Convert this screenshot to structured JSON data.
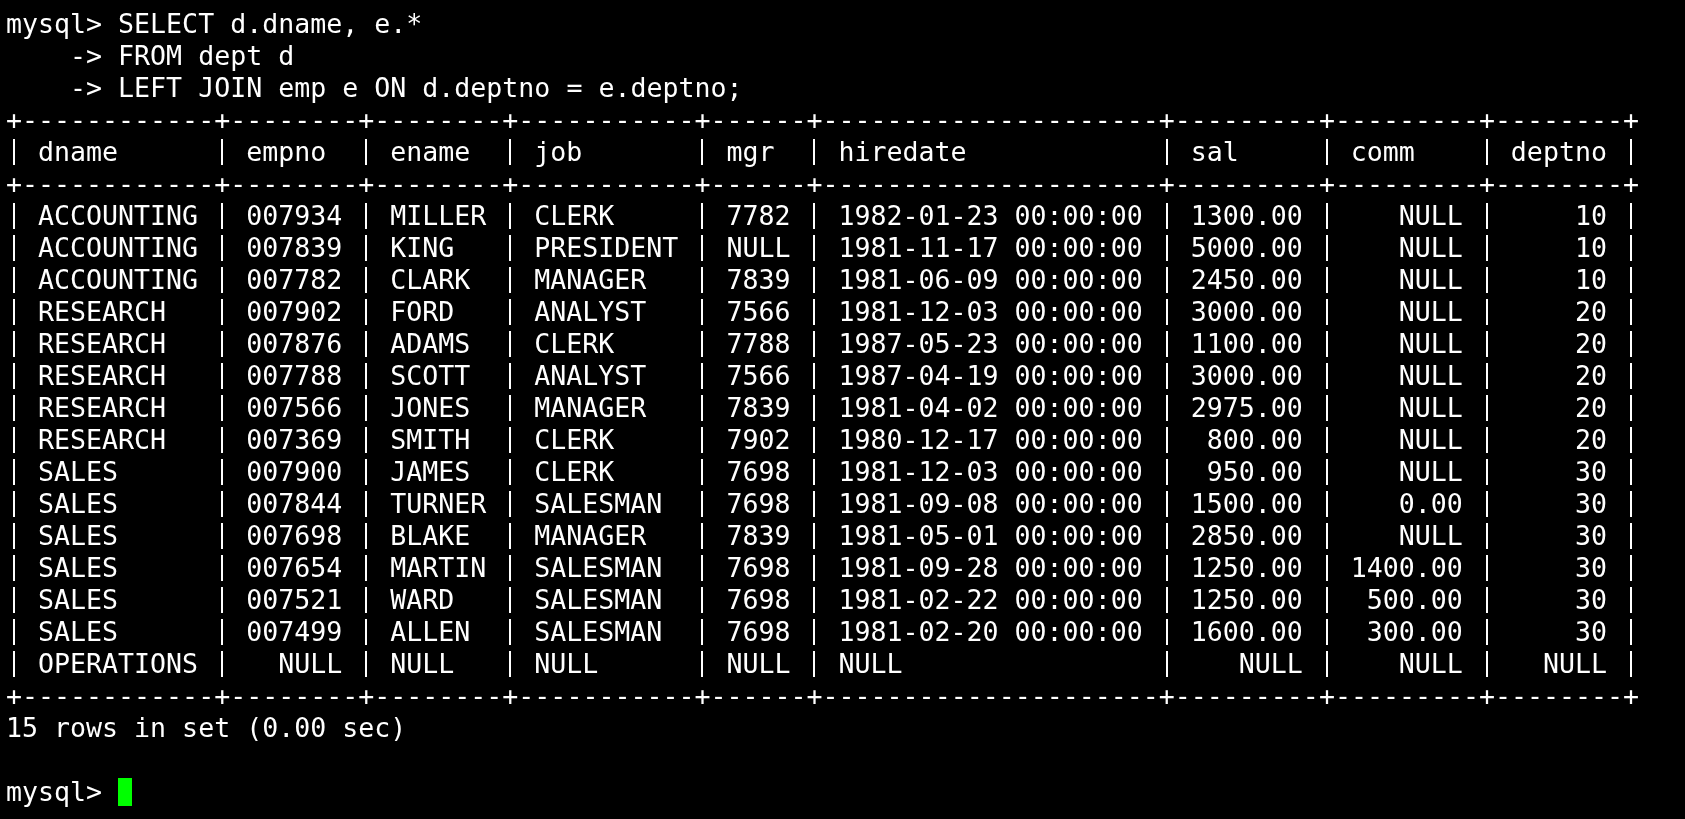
{
  "terminal": {
    "query_lines": [
      "mysql> SELECT d.dname, e.*",
      "    -> FROM dept d",
      "    -> LEFT JOIN emp e ON d.deptno = e.deptno;"
    ],
    "result_table": {
      "border_top": "+------------+--------+--------+-----------+------+---------------------+---------+---------+--------+",
      "columns": [
        {
          "name": "dname",
          "kind": "text"
        },
        {
          "name": "empno",
          "kind": "numeric"
        },
        {
          "name": "ename",
          "kind": "text"
        },
        {
          "name": "job",
          "kind": "text"
        },
        {
          "name": "mgr",
          "kind": "numeric"
        },
        {
          "name": "hiredate",
          "kind": "text"
        },
        {
          "name": "sal",
          "kind": "numeric"
        },
        {
          "name": "comm",
          "kind": "numeric"
        },
        {
          "name": "deptno",
          "kind": "numeric"
        }
      ],
      "border_header": "+------------+--------+--------+-----------+------+---------------------+---------+---------+--------+",
      "rows": [
        [
          "ACCOUNTING",
          "007934",
          "MILLER",
          "CLERK",
          "7782",
          "1982-01-23 00:00:00",
          "1300.00",
          "NULL",
          "10"
        ],
        [
          "ACCOUNTING",
          "007839",
          "KING",
          "PRESIDENT",
          "NULL",
          "1981-11-17 00:00:00",
          "5000.00",
          "NULL",
          "10"
        ],
        [
          "ACCOUNTING",
          "007782",
          "CLARK",
          "MANAGER",
          "7839",
          "1981-06-09 00:00:00",
          "2450.00",
          "NULL",
          "10"
        ],
        [
          "RESEARCH",
          "007902",
          "FORD",
          "ANALYST",
          "7566",
          "1981-12-03 00:00:00",
          "3000.00",
          "NULL",
          "20"
        ],
        [
          "RESEARCH",
          "007876",
          "ADAMS",
          "CLERK",
          "7788",
          "1987-05-23 00:00:00",
          "1100.00",
          "NULL",
          "20"
        ],
        [
          "RESEARCH",
          "007788",
          "SCOTT",
          "ANALYST",
          "7566",
          "1987-04-19 00:00:00",
          "3000.00",
          "NULL",
          "20"
        ],
        [
          "RESEARCH",
          "007566",
          "JONES",
          "MANAGER",
          "7839",
          "1981-04-02 00:00:00",
          "2975.00",
          "NULL",
          "20"
        ],
        [
          "RESEARCH",
          "007369",
          "SMITH",
          "CLERK",
          "7902",
          "1980-12-17 00:00:00",
          "800.00",
          "NULL",
          "20"
        ],
        [
          "SALES",
          "007900",
          "JAMES",
          "CLERK",
          "7698",
          "1981-12-03 00:00:00",
          "950.00",
          "NULL",
          "30"
        ],
        [
          "SALES",
          "007844",
          "TURNER",
          "SALESMAN",
          "7698",
          "1981-09-08 00:00:00",
          "1500.00",
          "0.00",
          "30"
        ],
        [
          "SALES",
          "007698",
          "BLAKE",
          "MANAGER",
          "7839",
          "1981-05-01 00:00:00",
          "2850.00",
          "NULL",
          "30"
        ],
        [
          "SALES",
          "007654",
          "MARTIN",
          "SALESMAN",
          "7698",
          "1981-09-28 00:00:00",
          "1250.00",
          "1400.00",
          "30"
        ],
        [
          "SALES",
          "007521",
          "WARD",
          "SALESMAN",
          "7698",
          "1981-02-22 00:00:00",
          "1250.00",
          "500.00",
          "30"
        ],
        [
          "SALES",
          "007499",
          "ALLEN",
          "SALESMAN",
          "7698",
          "1981-02-20 00:00:00",
          "1600.00",
          "300.00",
          "30"
        ],
        [
          "OPERATIONS",
          "NULL",
          "NULL",
          "NULL",
          "NULL",
          "NULL",
          "NULL",
          "NULL",
          "NULL"
        ]
      ],
      "border_bottom": "+------------+--------+--------+-----------+------+---------------------+---------+---------+--------+"
    },
    "summary": "15 rows in set (0.00 sec)",
    "prompt": "mysql>"
  }
}
